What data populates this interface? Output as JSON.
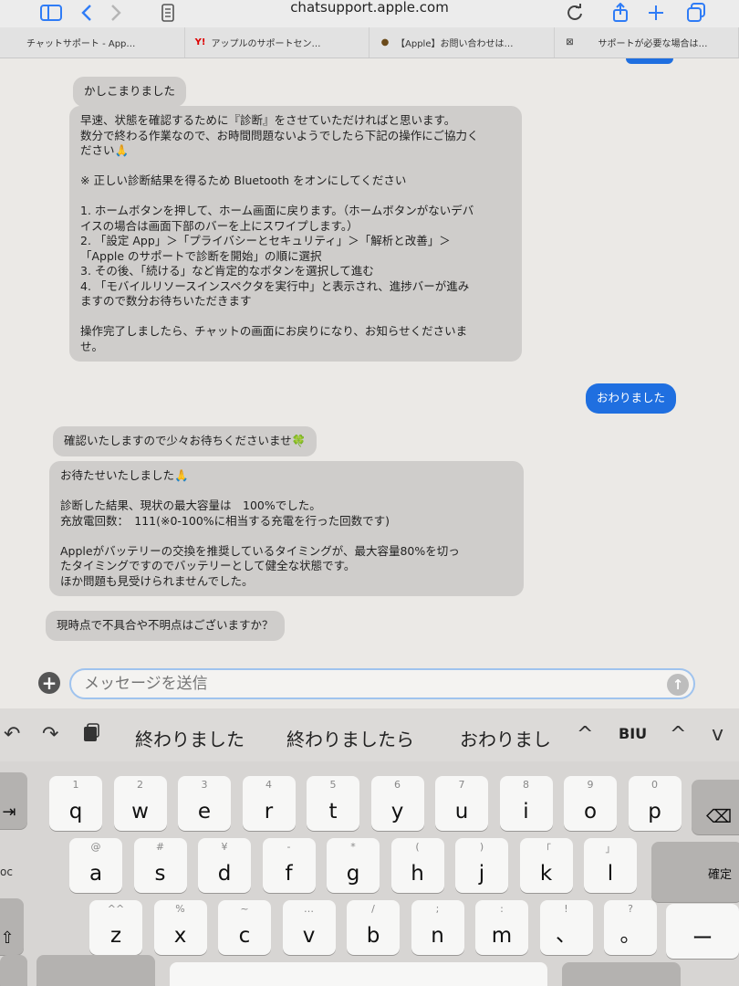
{
  "browser": {
    "url": "chatsupport.apple.com",
    "tabs": [
      {
        "label": "チャットサポート - App…",
        "favicon": "apple-icon"
      },
      {
        "label": "アップルのサポートセン…",
        "favicon": "yahoo-icon"
      },
      {
        "label": "【Apple】お問い合わせは…",
        "favicon": "chick-icon"
      },
      {
        "label": "サポートが必要な場合は…",
        "favicon": "apple-icon"
      }
    ]
  },
  "chat": {
    "messages": [
      {
        "from": "agent",
        "text": "かしこまりました"
      },
      {
        "from": "agent",
        "text": "早速、状態を確認するために『診断』をさせていただければと思います。\n数分で終わる作業なので、お時間問題ないようでしたら下記の操作にご協力く\nださい🙏\n\n※ 正しい診断結果を得るため Bluetooth をオンにしてください\n\n1. ホームボタンを押して、ホーム画面に戻ります。（ホームボタンがないデバ\nイスの場合は画面下部のバーを上にスワイプします。）\n2. 「設定 App」＞「プライバシーとセキュリティ」＞「解析と改善」＞\n「Apple のサポートで診断を開始」の順に選択\n3. その後、「続ける」など肯定的なボタンを選択して進む\n4. 「モバイルリソースインスペクタを実行中」と表示され、進捗バーが進み\nますので数分お待ちいただきます\n\n操作完了しましたら、チャットの画面にお戻りになり、お知らせくださいま\nせ。"
      },
      {
        "from": "user",
        "text": "おわりました"
      },
      {
        "from": "agent",
        "text": "確認いたしますので少々お待ちくださいませ🍀"
      },
      {
        "from": "agent",
        "text": "お待たせいたしました🙏\n\n診断した結果、現状の最大容量は　100%でした。\n充放電回数：　111(※0-100%に相当する充電を行った回数です)\n\nAppleがバッテリーの交換を推奨しているタイミングが、最大容量80%を切っ\nたタイミングですのでバッテリーとして健全な状態です。\nほか問題も見受けられませんでした。"
      },
      {
        "from": "agent",
        "text": "現時点で不具合や不明点はございますか？"
      }
    ]
  },
  "composer": {
    "placeholder": "メッセージを送信"
  },
  "keyboard": {
    "suggestions": [
      "終わりました",
      "終わりましたら",
      "おわりまし"
    ],
    "format_label": "BIU",
    "row1": [
      {
        "main": "q",
        "sub": "1"
      },
      {
        "main": "w",
        "sub": "2"
      },
      {
        "main": "e",
        "sub": "3"
      },
      {
        "main": "r",
        "sub": "4"
      },
      {
        "main": "t",
        "sub": "5"
      },
      {
        "main": "y",
        "sub": "6"
      },
      {
        "main": "u",
        "sub": "7"
      },
      {
        "main": "i",
        "sub": "8"
      },
      {
        "main": "o",
        "sub": "9"
      },
      {
        "main": "p",
        "sub": "0"
      }
    ],
    "row2": [
      {
        "main": "a",
        "sub": "@"
      },
      {
        "main": "s",
        "sub": "#"
      },
      {
        "main": "d",
        "sub": "¥"
      },
      {
        "main": "f",
        "sub": "-"
      },
      {
        "main": "g",
        "sub": "*"
      },
      {
        "main": "h",
        "sub": "("
      },
      {
        "main": "j",
        "sub": ")"
      },
      {
        "main": "k",
        "sub": "「"
      },
      {
        "main": "l",
        "sub": "」"
      }
    ],
    "row3": [
      {
        "main": "z",
        "sub": "^^"
      },
      {
        "main": "x",
        "sub": "%"
      },
      {
        "main": "c",
        "sub": "~"
      },
      {
        "main": "v",
        "sub": "…"
      },
      {
        "main": "b",
        "sub": "/"
      },
      {
        "main": "n",
        "sub": ";"
      },
      {
        "main": "m",
        "sub": ":"
      },
      {
        "main": "、",
        "sub": "!"
      },
      {
        "main": "。",
        "sub": "?"
      }
    ],
    "left_label": "oc",
    "confirm_label": "確定",
    "dash_label": "ー"
  }
}
